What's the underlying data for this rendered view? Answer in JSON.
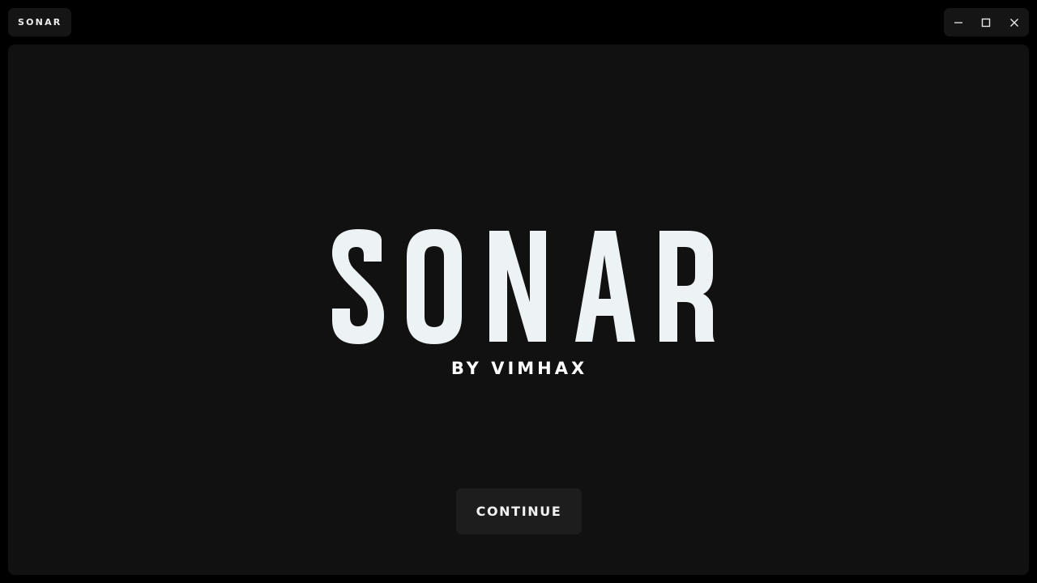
{
  "titlebar": {
    "app_name": "SONAR",
    "controls": [
      {
        "name": "minimize",
        "icon": "minimize-icon"
      },
      {
        "name": "maximize",
        "icon": "maximize-icon"
      },
      {
        "name": "close",
        "icon": "close-icon"
      }
    ]
  },
  "splash": {
    "logo_text": "SONAR",
    "byline": "BY VIMHAX",
    "continue_label": "CONTINUE"
  },
  "colors": {
    "window_bg": "#000000",
    "content_bg": "#111111",
    "logo": "#edf2f5",
    "button_bg": "#1d1d1d",
    "text": "#ffffff"
  }
}
